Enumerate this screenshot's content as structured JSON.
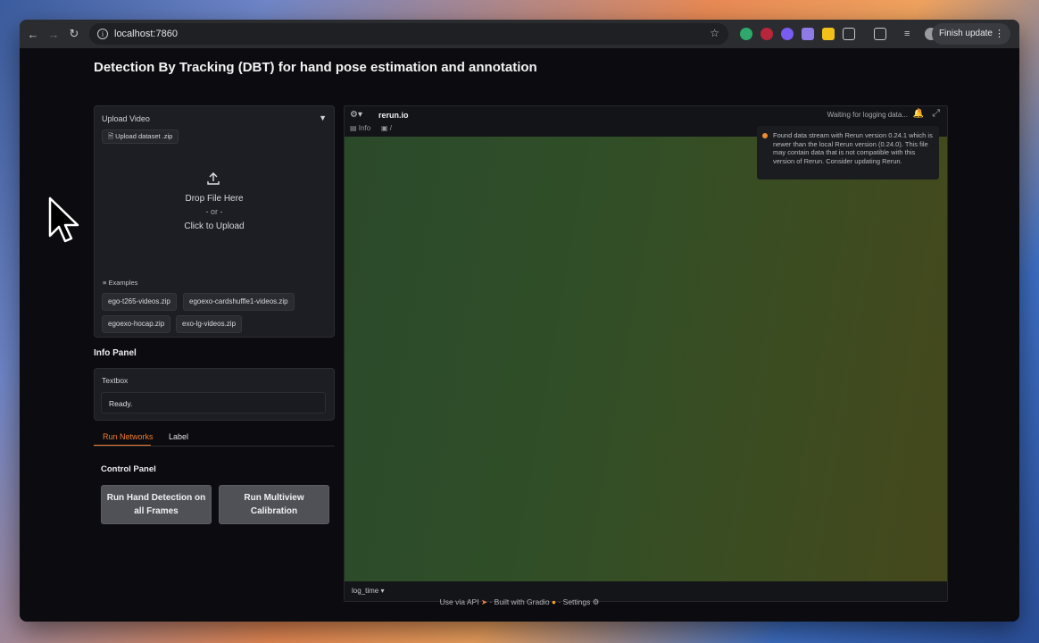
{
  "browser": {
    "url": "localhost:7860",
    "finish_update_label": "Finish update"
  },
  "page": {
    "title": "Detection By Tracking (DBT) for hand pose estimation and annotation"
  },
  "upload": {
    "header": "Upload Video",
    "file_label": "Upload dataset .zip",
    "drop_text": "Drop File Here",
    "or_text": "- or -",
    "click_text": "Click to Upload",
    "examples_label": "Examples",
    "examples": [
      "ego-t265-videos.zip",
      "egoexo-cardshuffle1-videos.zip",
      "egoexo-hocap.zip",
      "exo-lg-videos.zip"
    ]
  },
  "info_panel": {
    "title": "Info Panel",
    "textbox_label": "Textbox",
    "textbox_value": "Ready."
  },
  "tabs": {
    "items": [
      "Run Networks",
      "Label"
    ],
    "active": "Run Networks"
  },
  "control_panel": {
    "title": "Control Panel",
    "hand_detection_button": "Run Hand Detection on all Frames",
    "calibration_button": "Run Multiview Calibration"
  },
  "viewer": {
    "brand": "rerun.io",
    "status": "Waiting for logging data...",
    "info_tab": "Info",
    "path": "/",
    "notice": "Found data stream with Rerun version 0.24.1 which is newer than the local Rerun version (0.24.0). This file may contain data that is not compatible with this version of Rerun. Consider updating Rerun.",
    "timeline": "log_time"
  },
  "footer": {
    "api": "Use via API",
    "built": "Built with Gradio",
    "settings": "Settings",
    "separator": "·"
  },
  "colors": {
    "active_tab": "#f07a2a",
    "notice_dot": "#f08c30"
  }
}
